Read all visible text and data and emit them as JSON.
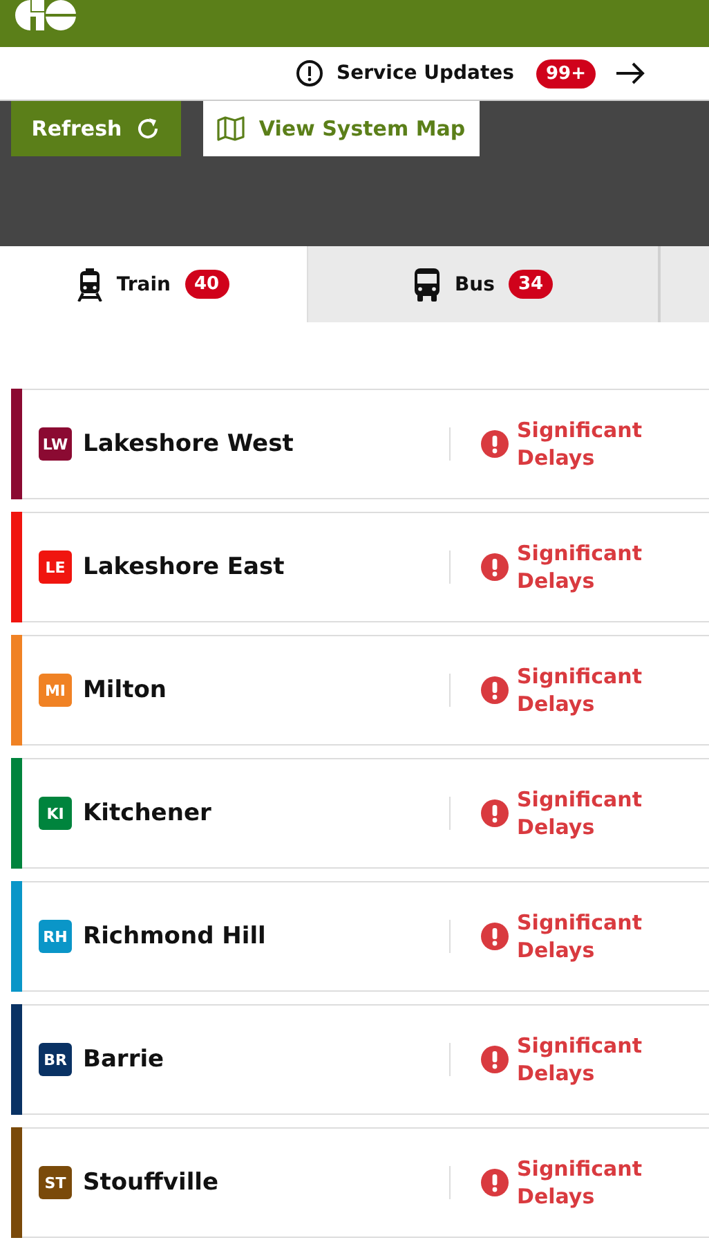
{
  "service_updates": {
    "label": "Service Updates",
    "count": "99+"
  },
  "actions": {
    "refresh": "Refresh",
    "map": "View System Map"
  },
  "tabs": [
    {
      "label": "Train",
      "count": "40",
      "kind": "train",
      "selected": true
    },
    {
      "label": "Bus",
      "count": "34",
      "kind": "bus",
      "selected": false
    },
    {
      "kind": "cut",
      "selected": false
    }
  ],
  "lines": [
    {
      "code": "LW",
      "name": "Lakeshore West",
      "color": "#8b0a32",
      "status": "Significant Delays"
    },
    {
      "code": "LE",
      "name": "Lakeshore East",
      "color": "#f0150f",
      "status": "Significant Delays"
    },
    {
      "code": "MI",
      "name": "Milton",
      "color": "#f08224",
      "status": "Significant Delays"
    },
    {
      "code": "KI",
      "name": "Kitchener",
      "color": "#00843d",
      "status": "Significant Delays"
    },
    {
      "code": "RH",
      "name": "Richmond Hill",
      "color": "#0a96c8",
      "status": "Significant Delays"
    },
    {
      "code": "BR",
      "name": "Barrie",
      "color": "#0a3264",
      "status": "Significant Delays"
    },
    {
      "code": "ST",
      "name": "Stouffville",
      "color": "#7a4a0a",
      "status": "Significant Delays"
    }
  ]
}
